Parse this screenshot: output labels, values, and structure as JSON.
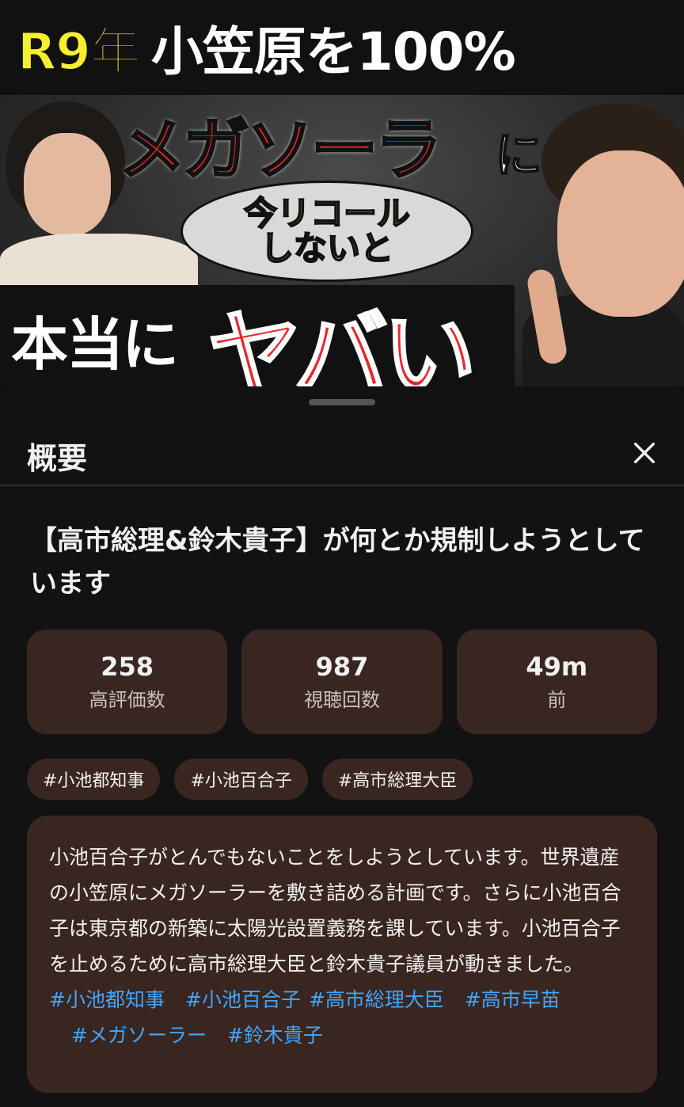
{
  "thumbnail": {
    "line1_year": "R9年",
    "line1_text": "小笠原を100%",
    "line2_red": "メガソーラ",
    "line2_suffix": "に",
    "bubble_line1": "今リコール",
    "bubble_line2": "しないと",
    "line3_white": "本当に",
    "line3_red": "ヤバい"
  },
  "sheet": {
    "title": "概要",
    "close_icon": "close-icon"
  },
  "video": {
    "title": "【高市総理&鈴木貴子】が何とか規制しようとしています"
  },
  "stats": [
    {
      "value": "258",
      "label": "高評価数"
    },
    {
      "value": "987",
      "label": "視聴回数"
    },
    {
      "value": "49m",
      "label": "前"
    }
  ],
  "tags": [
    "#小池都知事",
    "#小池百合子",
    "#高市総理大臣"
  ],
  "description": {
    "text": "小池百合子がとんでもないことをしようとしています。世界遺産の小笠原にメガソーラーを敷き詰める計画です。さらに小池百合子は東京都の新築に太陽光設置義務を課しています。小池百合子を止めるために高市総理大臣と鈴木貴子議員が動きました。",
    "hashtags": [
      "#小池都知事",
      "#小池百合子",
      "#高市総理大臣",
      "#高市早苗",
      "#メガソーラー",
      "#鈴木貴子"
    ]
  },
  "colors": {
    "background": "#0f0f0f",
    "card": "#3a2621",
    "hashtag_link": "#3ea6ff",
    "thumb_red": "#e8262a",
    "thumb_yellow": "#f6ef2d"
  }
}
